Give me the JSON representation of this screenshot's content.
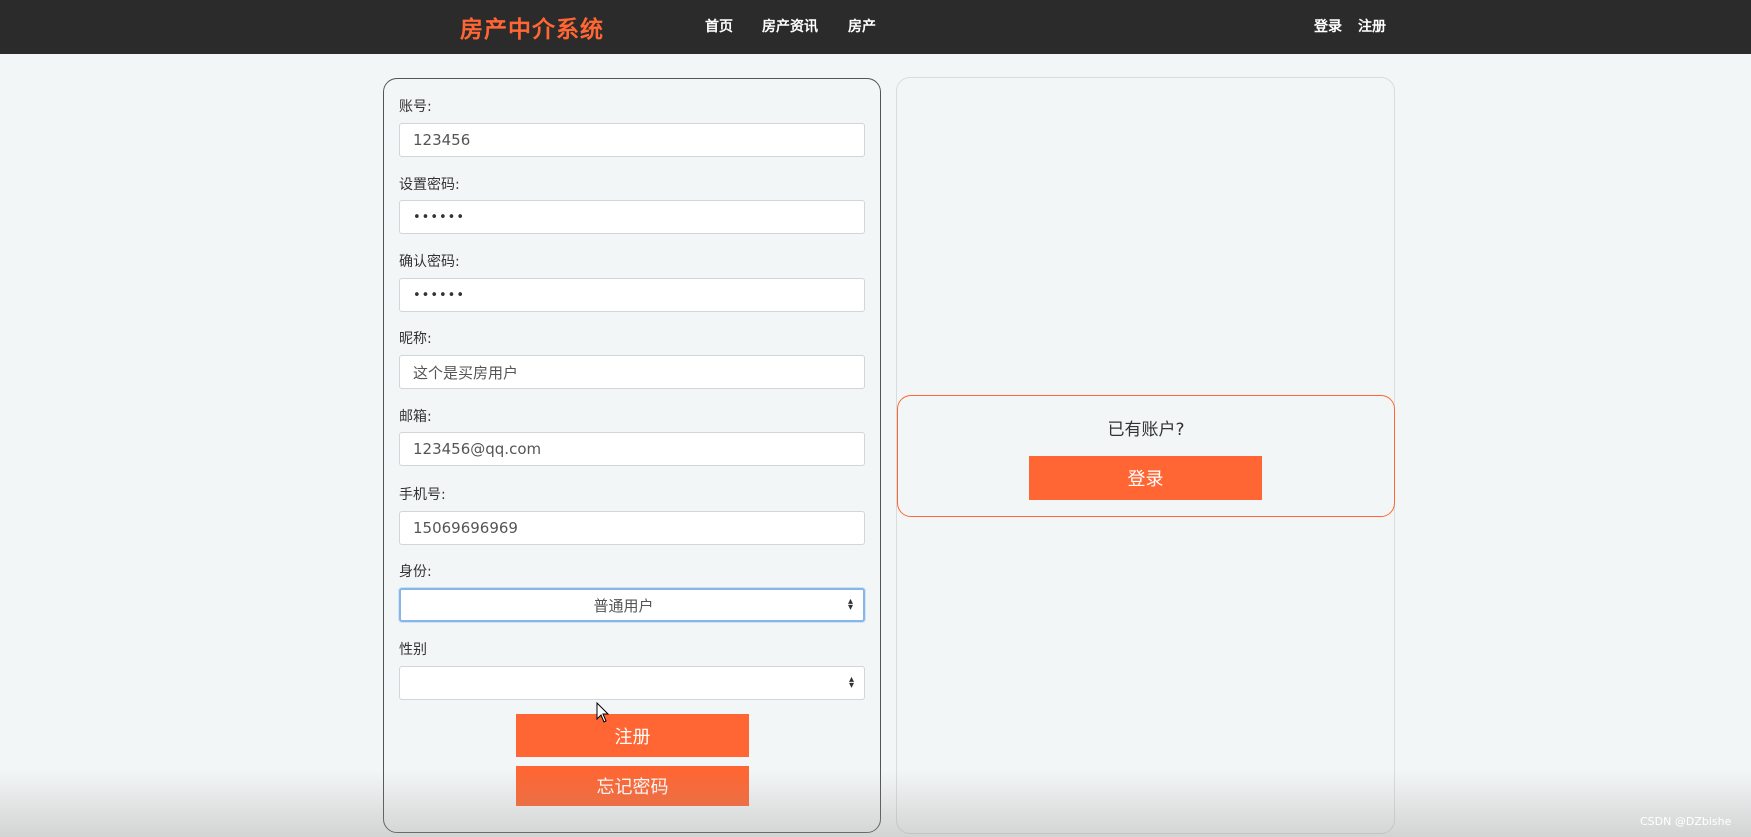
{
  "navbar": {
    "brand": "房产中介系统",
    "links": [
      "首页",
      "房产资讯",
      "房产"
    ],
    "login": "登录",
    "register": "注册"
  },
  "form": {
    "account_label": "账号:",
    "account_value": "123456",
    "password_label": "设置密码:",
    "password_value": "••••••",
    "confirm_label": "确认密码:",
    "confirm_value": "••••••",
    "nickname_label": "昵称:",
    "nickname_value": "这个是买房用户",
    "email_label": "邮箱:",
    "email_value": "123456@qq.com",
    "phone_label": "手机号:",
    "phone_value": "15069696969",
    "role_label": "身份:",
    "role_selected": "普通用户",
    "gender_label": "性别",
    "gender_selected": "",
    "register_button": "注册",
    "forgot_button": "忘记密码"
  },
  "side": {
    "question": "已有账户?",
    "login_button": "登录"
  },
  "watermark": "CSDN @DZbishe",
  "colors": {
    "accent": "#ff6633",
    "navbar_bg": "#2b2b2b",
    "page_bg": "#f3f6f6"
  }
}
